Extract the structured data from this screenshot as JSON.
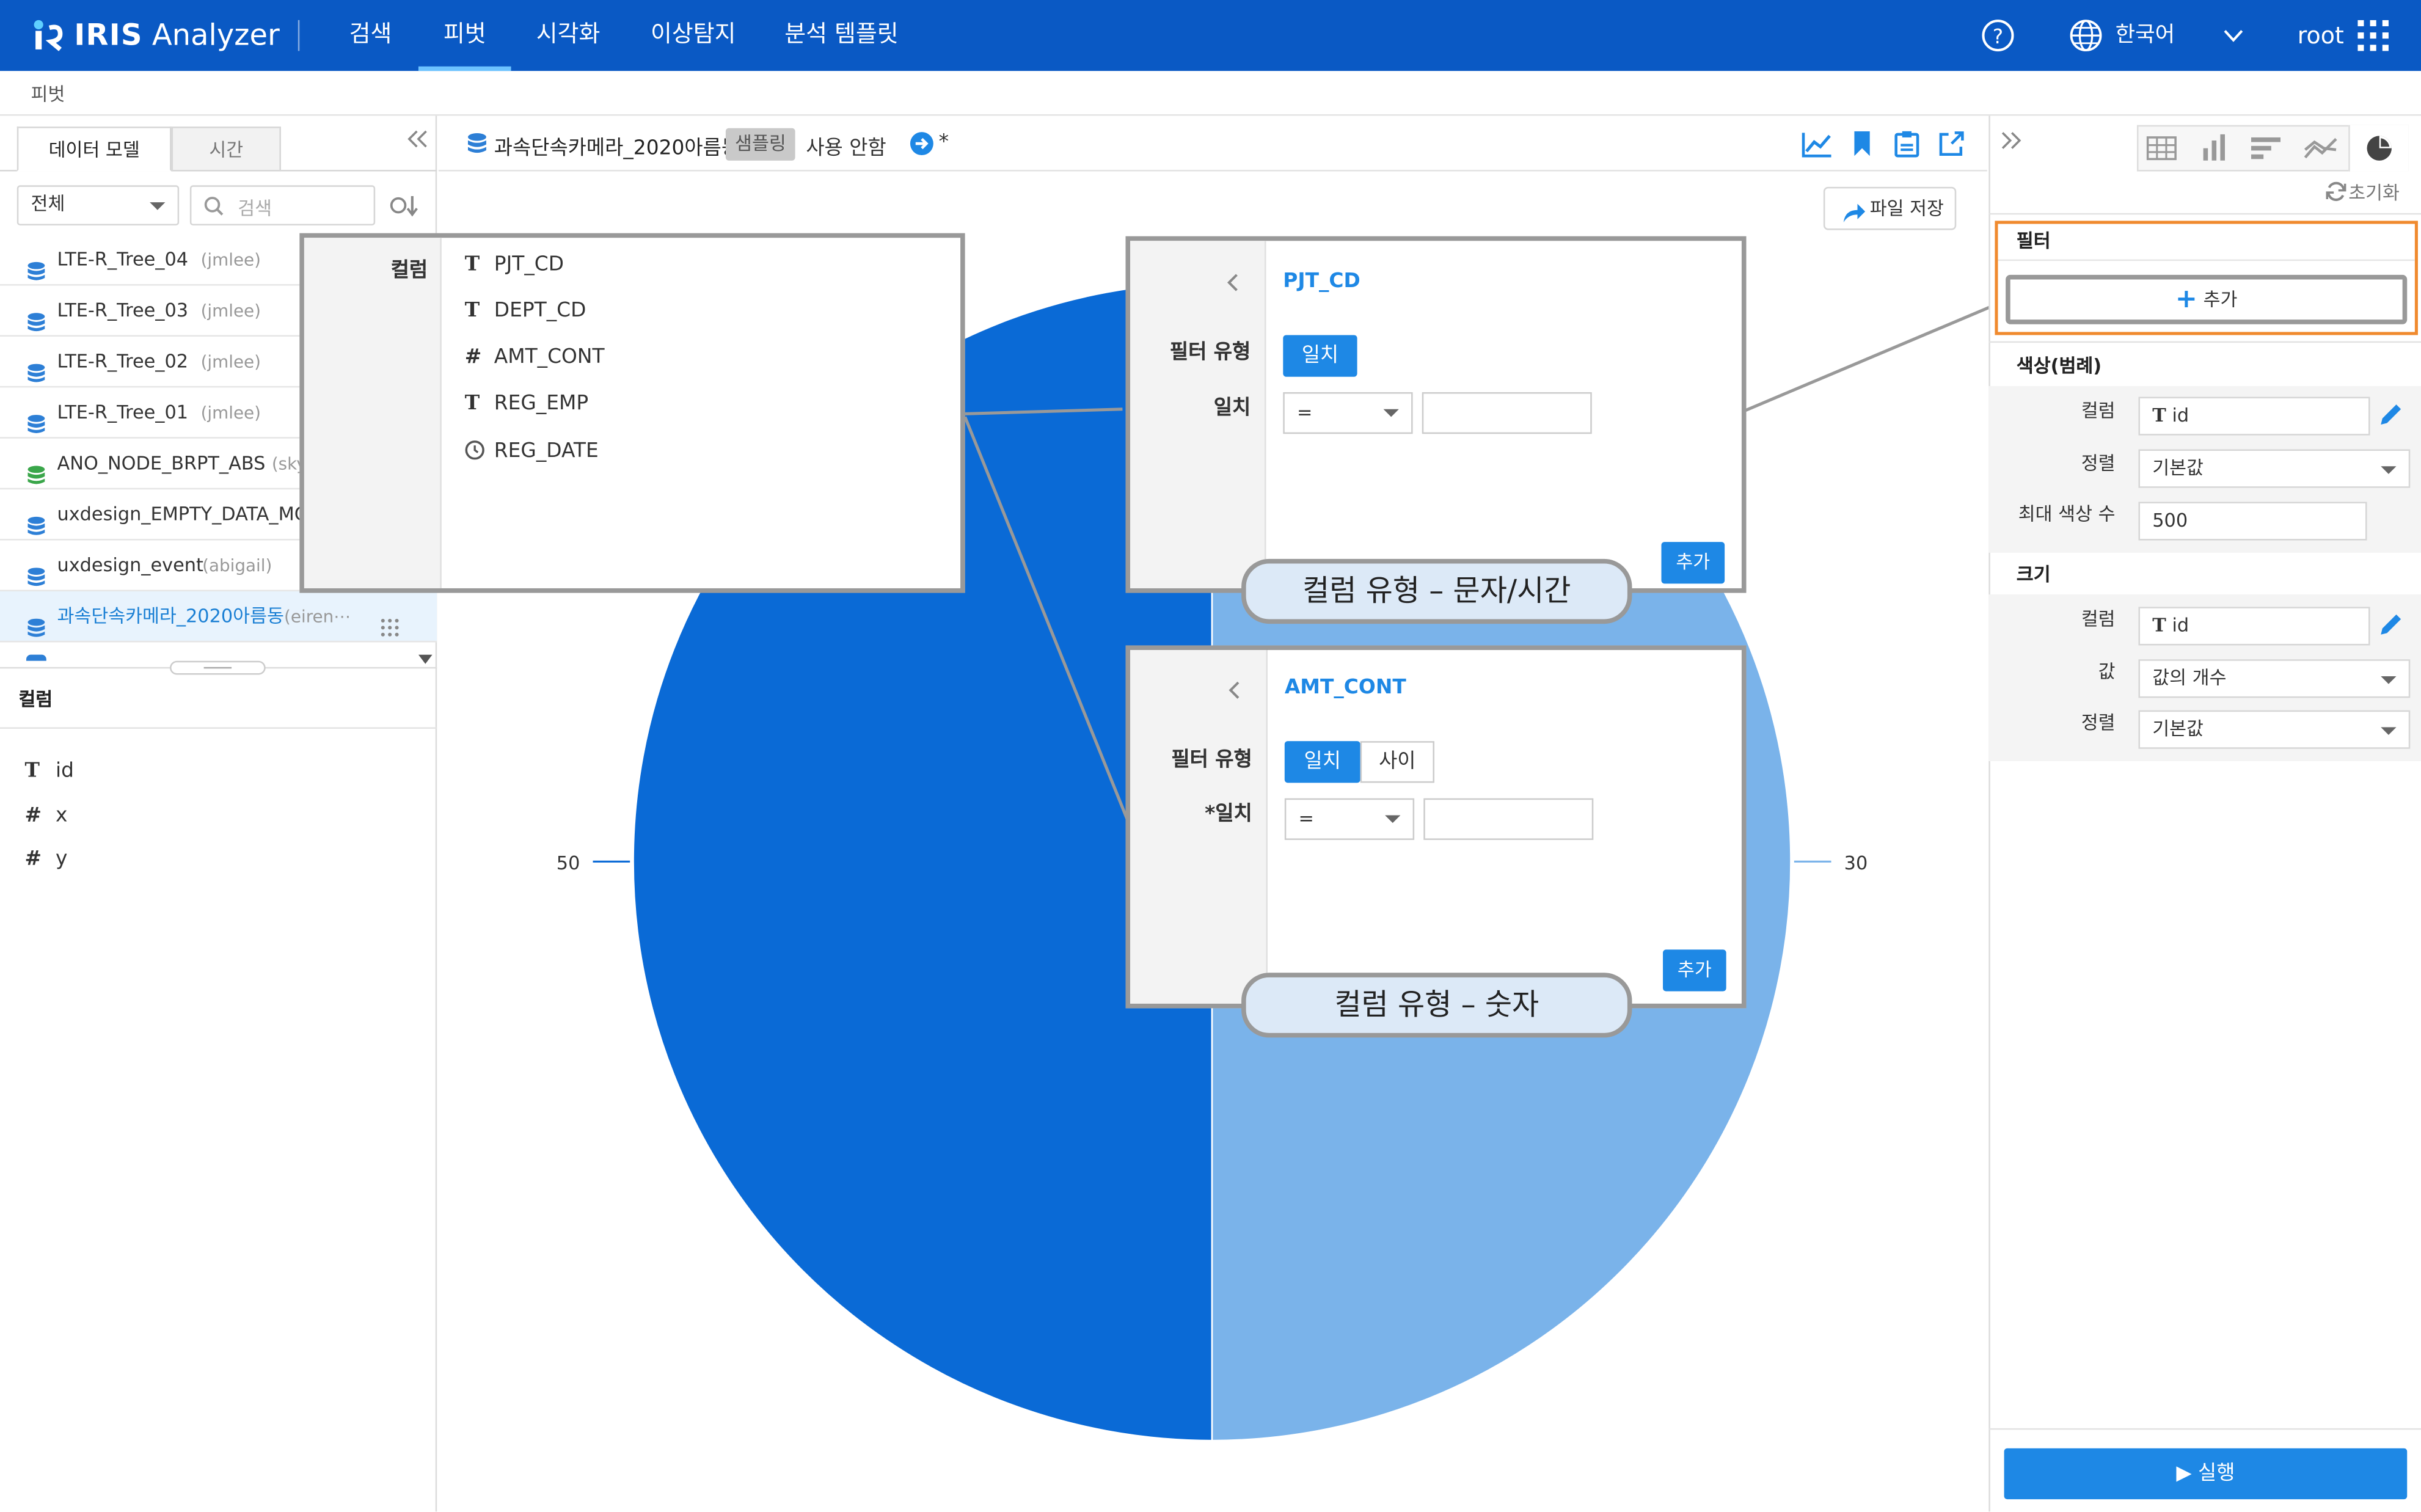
{
  "app": {
    "brand": "IRIS",
    "name": "Analyzer",
    "nav": [
      "검색",
      "피벗",
      "시각화",
      "이상탐지",
      "분석 템플릿"
    ],
    "language": "한국어",
    "user": "root"
  },
  "breadcrumb": "피벗",
  "left_panel": {
    "tabs": [
      "데이터 모델",
      "시간"
    ],
    "scope_select": "전체",
    "search_placeholder": "검색",
    "models": [
      {
        "name": "LTE-R_Tree_04",
        "owner": "(jmlee)"
      },
      {
        "name": "LTE-R_Tree_03",
        "owner": "(jmlee)"
      },
      {
        "name": "LTE-R_Tree_02",
        "owner": "(jmlee)"
      },
      {
        "name": "LTE-R_Tree_01",
        "owner": "(jmlee)"
      },
      {
        "name": "ANO_NODE_BRPT_ABS",
        "owner": "(sky"
      },
      {
        "name": "uxdesign_EMPTY_DATA_MC",
        "owner": ""
      },
      {
        "name": "uxdesign_event",
        "owner": "(abigail)"
      },
      {
        "name": "과속단속카메라_2020아름동",
        "owner": "(eiren⋯"
      }
    ],
    "columns_header": "컬럼",
    "columns": [
      {
        "type": "T",
        "name": "id"
      },
      {
        "type": "#",
        "name": "x"
      },
      {
        "type": "#",
        "name": "y"
      }
    ]
  },
  "center": {
    "model_title": "과속단속카메라_2020아름동",
    "sampling_badge": "샘플링",
    "sampling_state": "사용 안함",
    "modified_mark": "*",
    "save_button": "파일 저장"
  },
  "chart_data": {
    "type": "pie",
    "labels": [
      "50",
      "30"
    ],
    "values": [
      50,
      50
    ],
    "colors": [
      "#0a6ad6",
      "#7ab3ea"
    ]
  },
  "column_popup": {
    "label": "컬럼",
    "items": [
      {
        "type": "T",
        "name": "PJT_CD"
      },
      {
        "type": "T",
        "name": "DEPT_CD"
      },
      {
        "type": "#",
        "name": "AMT_CONT"
      },
      {
        "type": "T",
        "name": "REG_EMP"
      },
      {
        "type": "clock",
        "name": "REG_DATE"
      }
    ]
  },
  "filter_popup_text": {
    "column": "PJT_CD",
    "type_label": "필터 유형",
    "type_buttons": [
      "일치"
    ],
    "match_label": "일치",
    "operator": "=",
    "add_button": "추가",
    "callout": "컬럼 유형 – 문자/시간"
  },
  "filter_popup_number": {
    "column": "AMT_CONT",
    "type_label": "필터 유형",
    "type_buttons": [
      "일치",
      "사이"
    ],
    "match_label": "*일치",
    "operator": "=",
    "add_button": "추가",
    "callout": "컬럼 유형 – 숫자"
  },
  "right_panel": {
    "reset": "초기화",
    "filter_header": "필터",
    "filter_add": "추가",
    "color_section": "색상(범례)",
    "color_column_label": "컬럼",
    "color_column_value": "id",
    "color_sort_label": "정렬",
    "color_sort_value": "기본값",
    "max_colors_label": "최대 색상 수",
    "max_colors_value": "500",
    "size_section": "크기",
    "size_column_label": "컬럼",
    "size_column_value": "id",
    "size_value_label": "값",
    "size_value_value": "값의 개수",
    "size_sort_label": "정렬",
    "size_sort_value": "기본값",
    "run_button": "▶ 실행"
  }
}
